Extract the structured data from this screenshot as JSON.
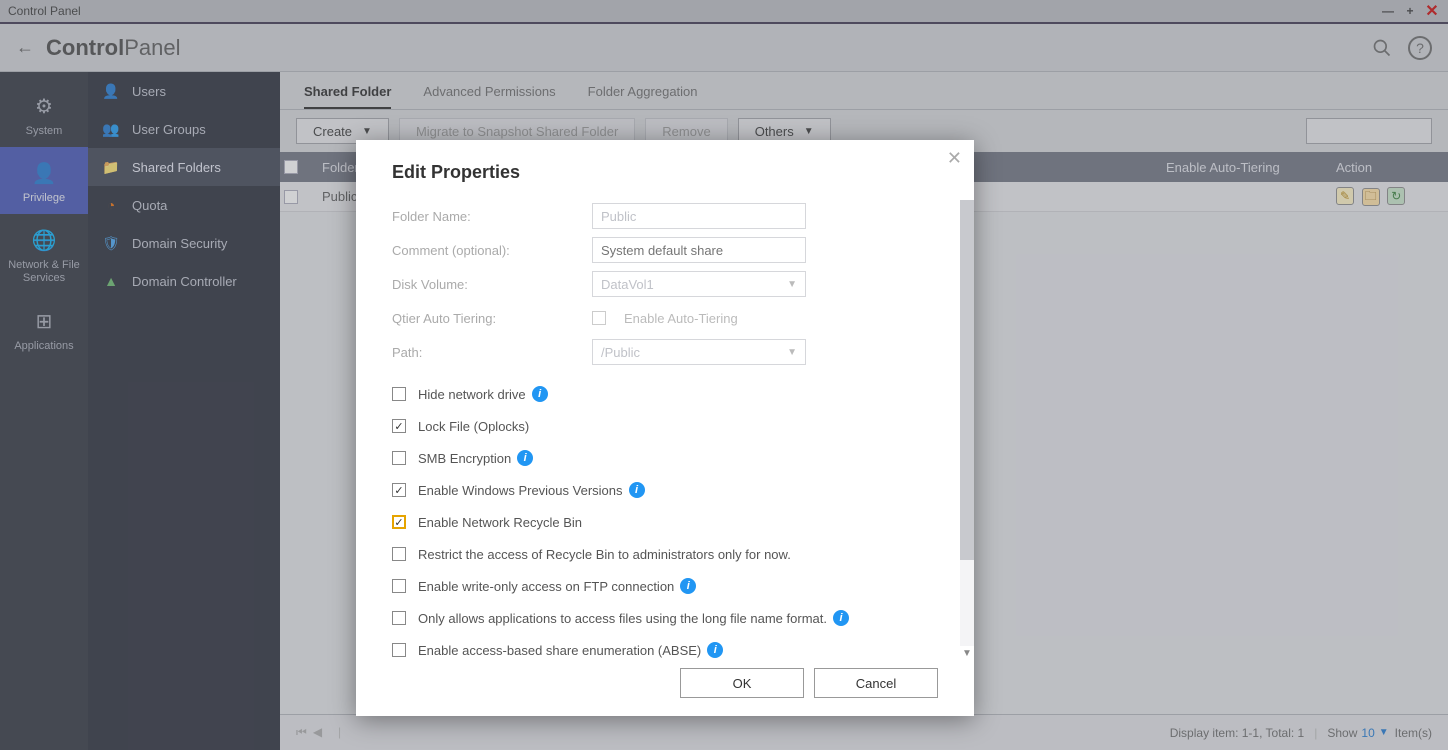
{
  "window": {
    "title": "Control Panel"
  },
  "header": {
    "app_bold": "Control",
    "app_light": "Panel"
  },
  "rail": [
    {
      "label": "System",
      "icon": "⚙"
    },
    {
      "label": "Privilege",
      "icon": "👤",
      "active": true
    },
    {
      "label": "Network & File Services",
      "icon": "🌐"
    },
    {
      "label": "Applications",
      "icon": "⊞"
    }
  ],
  "sidebar": [
    {
      "label": "Users",
      "iconClass": "si-user",
      "glyph": "👤"
    },
    {
      "label": "User Groups",
      "iconClass": "si-group",
      "glyph": "👥"
    },
    {
      "label": "Shared Folders",
      "iconClass": "si-folder",
      "glyph": "📁",
      "active": true
    },
    {
      "label": "Quota",
      "iconClass": "si-quota",
      "glyph": "◔"
    },
    {
      "label": "Domain Security",
      "iconClass": "si-shield",
      "glyph": "🛡"
    },
    {
      "label": "Domain Controller",
      "iconClass": "si-dc",
      "glyph": "▲"
    }
  ],
  "tabs": [
    {
      "label": "Shared Folder",
      "active": true
    },
    {
      "label": "Advanced Permissions"
    },
    {
      "label": "Folder Aggregation"
    }
  ],
  "toolbar": {
    "create": "Create",
    "migrate": "Migrate to Snapshot Shared Folder",
    "remove": "Remove",
    "others": "Others"
  },
  "grid": {
    "headers": {
      "folder": "Folder",
      "tier": "Enable Auto-Tiering",
      "action": "Action"
    },
    "rows": [
      {
        "folder": "Public"
      }
    ]
  },
  "pager": {
    "display": "Display item: 1-1, Total: 1",
    "show": "Show",
    "count": "10",
    "items": "Item(s)"
  },
  "modal": {
    "title": "Edit Properties",
    "labels": {
      "folder_name": "Folder Name:",
      "comment": "Comment (optional):",
      "disk_volume": "Disk Volume:",
      "qtier": "Qtier Auto Tiering:",
      "path": "Path:",
      "enable_tiering": "Enable Auto-Tiering"
    },
    "values": {
      "folder_name": "Public",
      "comment_placeholder": "System default share",
      "disk_volume": "DataVol1",
      "path": "/Public"
    },
    "checks": [
      {
        "label": "Hide network drive",
        "checked": false,
        "info": true
      },
      {
        "label": "Lock File (Oplocks)",
        "checked": true,
        "info": false
      },
      {
        "label": "SMB Encryption",
        "checked": false,
        "info": true
      },
      {
        "label": "Enable Windows Previous Versions",
        "checked": true,
        "info": true
      },
      {
        "label": "Enable Network Recycle Bin",
        "checked": true,
        "info": false,
        "highlight": true
      },
      {
        "label": "Restrict the access of Recycle Bin to administrators only for now.",
        "checked": false,
        "info": false
      },
      {
        "label": "Enable write-only access on FTP connection",
        "checked": false,
        "info": true
      },
      {
        "label": "Only allows applications to access files using the long file name format.",
        "checked": false,
        "info": true
      },
      {
        "label": "Enable access-based share enumeration (ABSE)",
        "checked": false,
        "info": true
      }
    ],
    "buttons": {
      "ok": "OK",
      "cancel": "Cancel"
    }
  }
}
